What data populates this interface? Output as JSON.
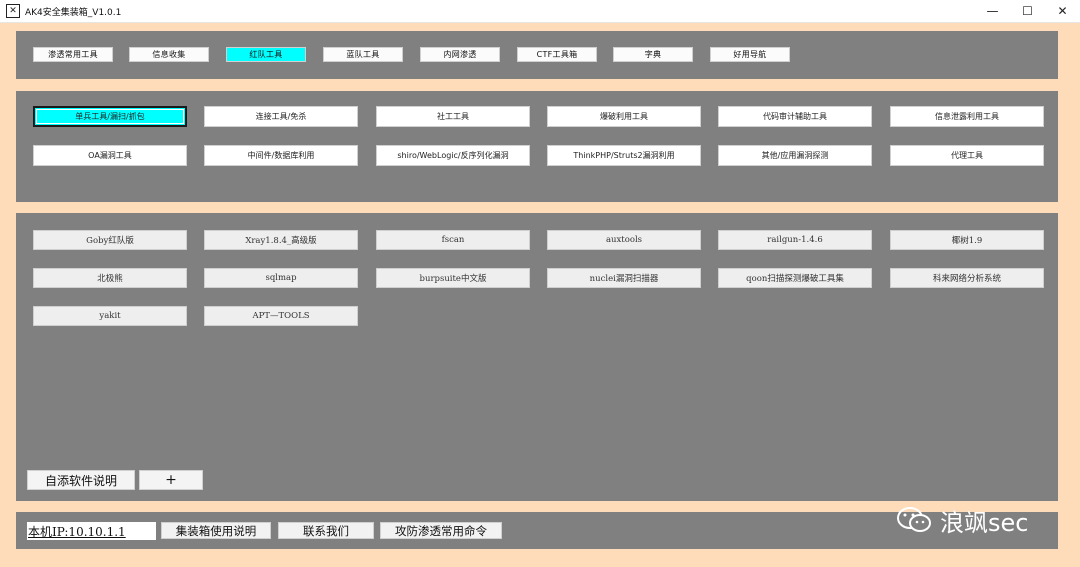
{
  "window": {
    "title": "AK4安全集装箱_V1.0.1",
    "icon_glyph": "✕",
    "controls": {
      "minimize": "—",
      "maximize": "☐",
      "close": "✕"
    }
  },
  "tabs": [
    {
      "label": "渗透常用工具",
      "active": false
    },
    {
      "label": "信息收集",
      "active": false
    },
    {
      "label": "红队工具",
      "active": true
    },
    {
      "label": "蓝队工具",
      "active": false
    },
    {
      "label": "内网渗透",
      "active": false
    },
    {
      "label": "CTF工具箱",
      "active": false
    },
    {
      "label": "字典",
      "active": false
    },
    {
      "label": "好用导航",
      "active": false
    }
  ],
  "categories": [
    {
      "label": "单兵工具/漏扫/抓包",
      "active": true
    },
    {
      "label": "连接工具/免杀",
      "active": false
    },
    {
      "label": "社工工具",
      "active": false
    },
    {
      "label": "爆破利用工具",
      "active": false
    },
    {
      "label": "代码审计辅助工具",
      "active": false
    },
    {
      "label": "信息泄露利用工具",
      "active": false
    },
    {
      "label": "OA漏洞工具",
      "active": false
    },
    {
      "label": "中间件/数据库利用",
      "active": false
    },
    {
      "label": "shiro/WebLogic/反序列化漏洞",
      "active": false
    },
    {
      "label": "ThinkPHP/Struts2漏洞利用",
      "active": false
    },
    {
      "label": "其他/应用漏洞探测",
      "active": false
    },
    {
      "label": "代理工具",
      "active": false
    }
  ],
  "tools": [
    "Goby红队版",
    "Xray1.8.4_高级版",
    "fscan",
    "auxtools",
    "railgun-1.4.6",
    "椰树1.9",
    "北极熊",
    "sqlmap",
    "burpsuite中文版",
    "nuclei漏洞扫描器",
    "qoon扫描探测爆破工具集",
    "科来网络分析系统",
    "yakit",
    "APT—TOOLS"
  ],
  "tool_actions": {
    "custom_help": "自添软件说明",
    "add": "+"
  },
  "bottom": {
    "ip_label": "本机IP:10.10.1.1",
    "usage": "集装箱使用说明",
    "contact": "联系我们",
    "commands": "攻防渗透常用命令"
  },
  "watermark": {
    "text": "浪飒sec"
  },
  "colors": {
    "background": "#ffdcb9",
    "panel": "#808080",
    "active": "#00ffff"
  }
}
